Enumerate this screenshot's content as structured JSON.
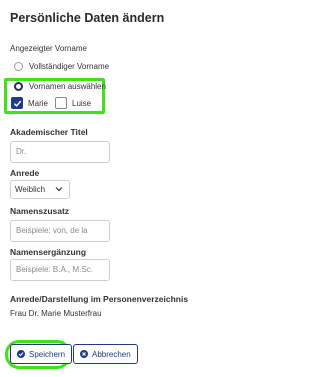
{
  "page": {
    "title": "Persönliche Daten ändern"
  },
  "displayed_first_name": {
    "label": "Angezeigter Vorname",
    "options": [
      {
        "label": "Vollständiger Vorname",
        "selected": false
      },
      {
        "label": "Vornamen auswählen",
        "selected": true
      }
    ],
    "names": [
      {
        "label": "Marie",
        "checked": true
      },
      {
        "label": "Luise",
        "checked": false
      }
    ]
  },
  "academic_title": {
    "label": "Akademischer Titel",
    "value": "Dr."
  },
  "salutation": {
    "label": "Anrede",
    "value": "Weiblich"
  },
  "name_addition": {
    "label": "Namenszusatz",
    "placeholder": "Beispiele: von, de la"
  },
  "name_suffix": {
    "label": "Namensergänzung",
    "placeholder": "Beispiele: B.A., M.Sc."
  },
  "directory_display": {
    "label": "Anrede/Darstellung im Personenverzeichnis",
    "value": "Frau Dr. Marie Musterfrau"
  },
  "buttons": {
    "save": "Speichern",
    "cancel": "Abbrechen"
  },
  "colors": {
    "primary": "#1f3a86",
    "highlight": "#43e01c"
  }
}
